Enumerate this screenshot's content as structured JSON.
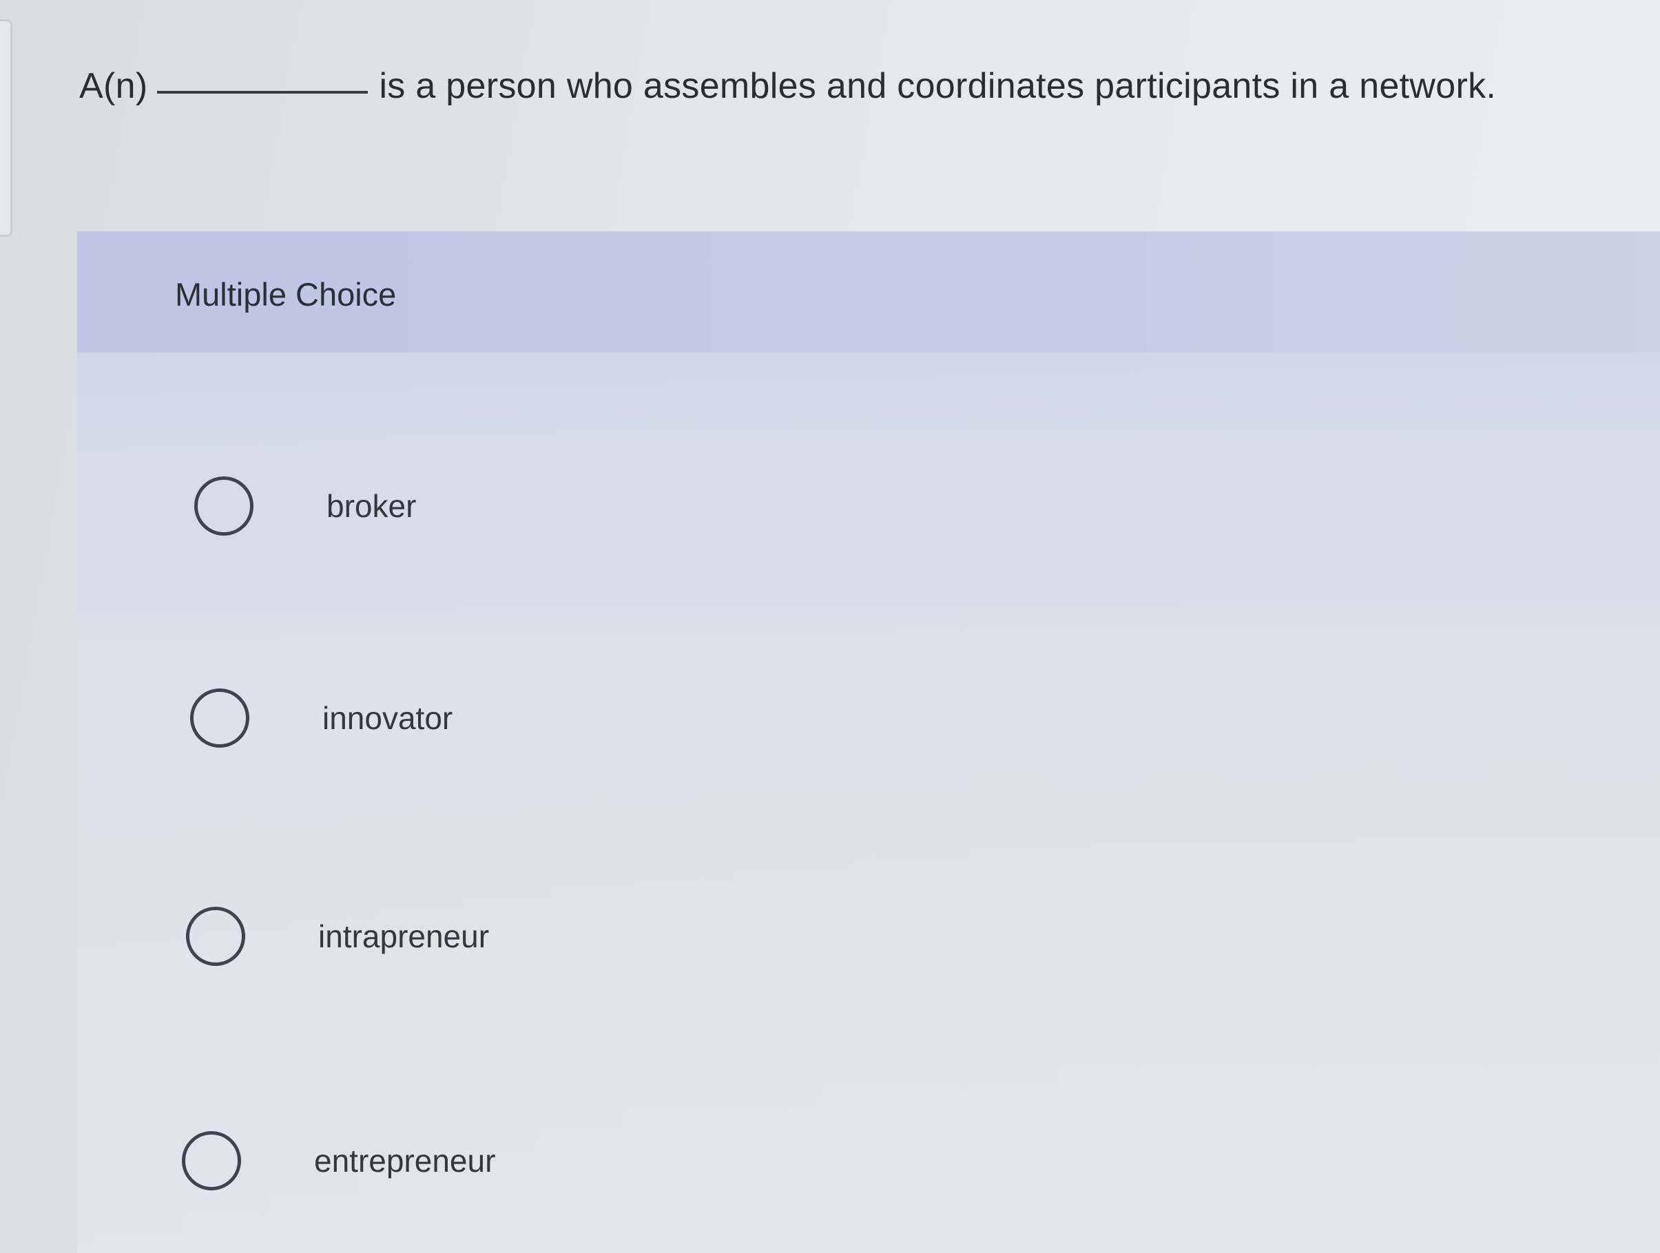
{
  "question": {
    "prefix": "A(n)",
    "suffix": "is a person who assembles and coordinates participants in a network."
  },
  "section_label": "Multiple Choice",
  "options": [
    {
      "label": "broker",
      "selected": false
    },
    {
      "label": "innovator",
      "selected": false
    },
    {
      "label": "intrapreneur",
      "selected": false
    },
    {
      "label": "entrepreneur",
      "selected": false
    }
  ]
}
